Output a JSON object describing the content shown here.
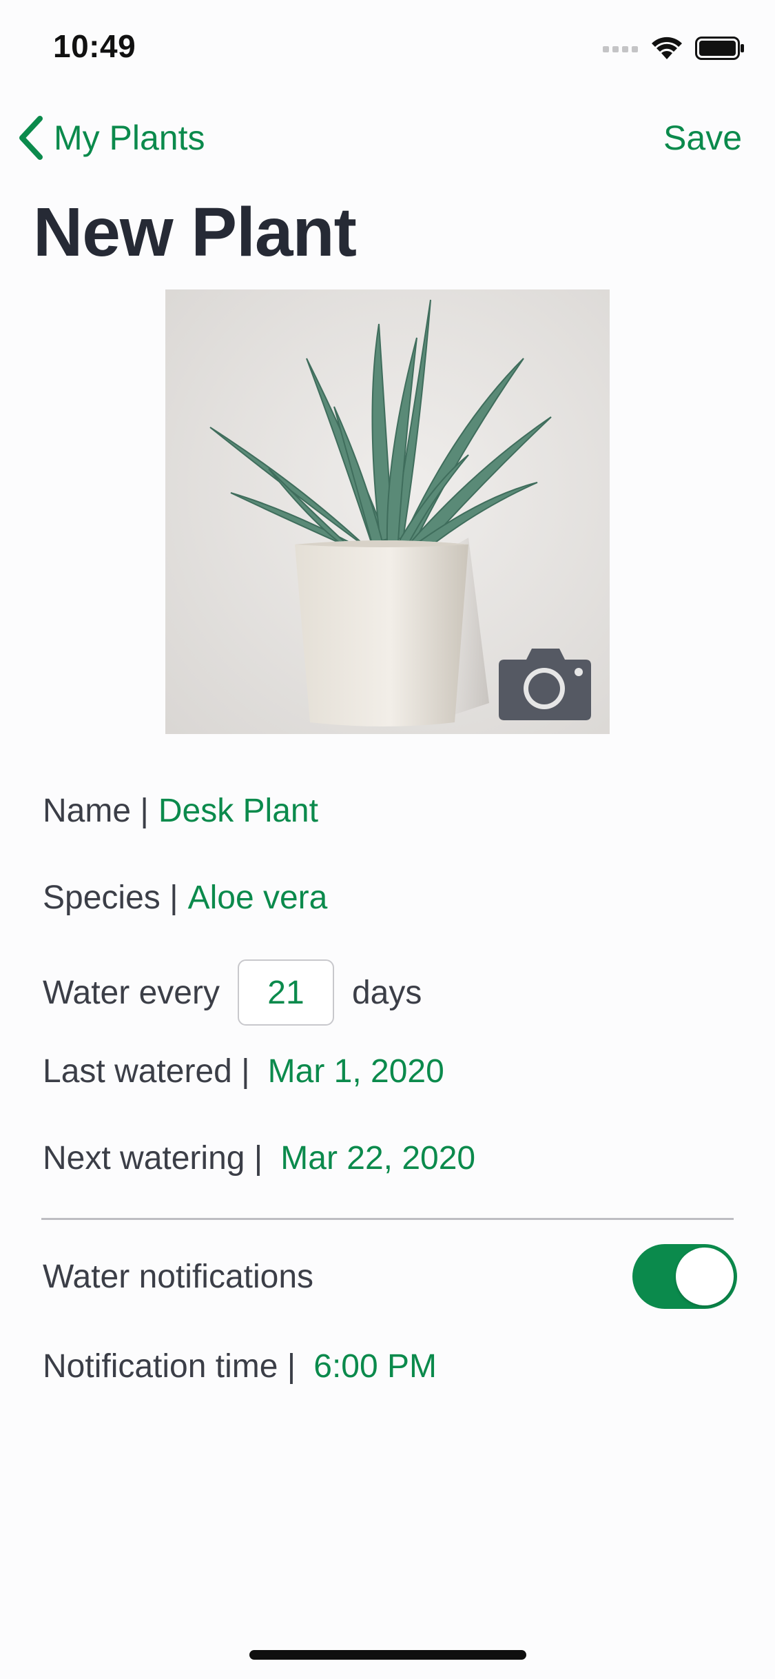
{
  "status_bar": {
    "time": "10:49"
  },
  "nav": {
    "back_label": "My Plants",
    "save_label": "Save"
  },
  "page_title": "New Plant",
  "form": {
    "name_label": "Name |",
    "name_value": "Desk Plant",
    "species_label": "Species |",
    "species_value": "Aloe vera",
    "water_every_label": "Water every",
    "water_every_value": "21",
    "water_every_unit": "days",
    "last_watered_label": "Last watered |",
    "last_watered_value": "Mar 1, 2020",
    "next_watering_label": "Next watering |",
    "next_watering_value": "Mar 22, 2020",
    "notifications_label": "Water notifications",
    "notifications_enabled": true,
    "notification_time_label": "Notification time |",
    "notification_time_value": "6:00 PM"
  },
  "colors": {
    "accent": "#0b8a4c",
    "title_text": "#262a35",
    "body_text": "#3b3e47",
    "background": "#fcfcfd"
  },
  "icons": {
    "back": "chevron-left-icon",
    "camera": "camera-icon",
    "wifi": "wifi-icon",
    "signal": "signal-icon",
    "battery": "battery-icon"
  }
}
